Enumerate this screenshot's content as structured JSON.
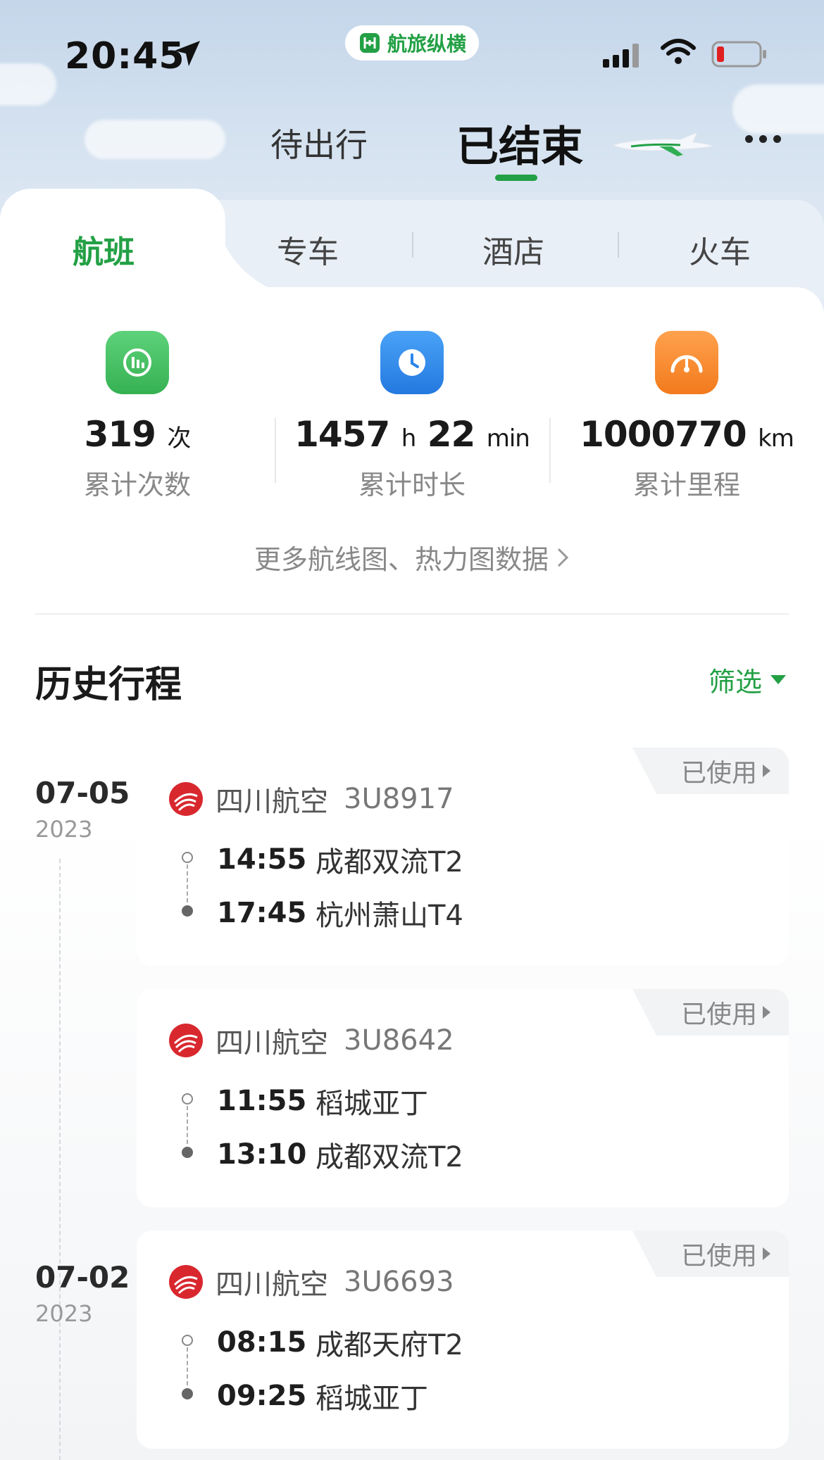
{
  "status_bar": {
    "time": "20:45",
    "app_badge": "航旅纵横"
  },
  "top_tabs": {
    "pending": "待出行",
    "finished": "已结束"
  },
  "category_tabs": [
    "航班",
    "专车",
    "酒店",
    "火车"
  ],
  "stats": [
    {
      "value": "319",
      "unit": "次",
      "label": "累计次数",
      "icon": "chart-icon",
      "color": "#3fba5c"
    },
    {
      "value_h": "1457",
      "unit_h": "h",
      "value_m": "22",
      "unit_m": "min",
      "label": "累计时长",
      "icon": "clock-icon",
      "color": "#2c86ea"
    },
    {
      "value": "1000770",
      "unit": "km",
      "label": "累计里程",
      "icon": "speedometer-icon",
      "color": "#f58a2f"
    }
  ],
  "more_data_link": "更多航线图、热力图数据",
  "history": {
    "title": "历史行程",
    "filter_label": "筛选",
    "groups": [
      {
        "date": "07-05",
        "year": "2023"
      },
      {
        "date": "07-02",
        "year": "2023"
      }
    ],
    "trips": [
      {
        "status": "已使用",
        "airline": "四川航空",
        "flight": "3U8917",
        "dep_time": "14:55",
        "dep_place": "成都双流T2",
        "arr_time": "17:45",
        "arr_place": "杭州萧山T4"
      },
      {
        "status": "已使用",
        "airline": "四川航空",
        "flight": "3U8642",
        "dep_time": "11:55",
        "dep_place": "稻城亚丁",
        "arr_time": "13:10",
        "arr_place": "成都双流T2"
      },
      {
        "status": "已使用",
        "airline": "四川航空",
        "flight": "3U6693",
        "dep_time": "08:15",
        "dep_place": "成都天府T2",
        "arr_time": "09:25",
        "arr_place": "稻城亚丁"
      }
    ]
  },
  "colors": {
    "accent": "#23a045",
    "airline_logo": "#d8282e"
  }
}
